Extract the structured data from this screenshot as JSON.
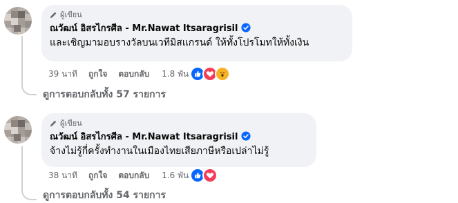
{
  "comments": [
    {
      "role_label": "ผู้เขียน",
      "author": "ณวัฒน์ อิสรไกรศีล - Mr.Nawat Itsaragrisil",
      "text": "และเชิญมามอบรางวัลบนเวทีมิสแกรนด์ ให้ทั้งโปรโมทให้ทั้งเงิน",
      "time": "39 นาที",
      "like_label": "ถูกใจ",
      "reply_label": "ตอบกลับ",
      "reaction_count": "1.8 พัน",
      "reactions": [
        "like-icon",
        "love-icon",
        "wow-icon"
      ],
      "replies_link": "ดูการตอบกลับทั้ง 57 รายการ"
    },
    {
      "role_label": "ผู้เขียน",
      "author": "ณวัฒน์ อิสรไกรศีล - Mr.Nawat Itsaragrisil",
      "text": "จ้างไม่รู้กี่ครั้งทำงานในเมืองไทยเสียภาษีหรือเปล่าไม่รู้",
      "time": "38 นาที",
      "like_label": "ถูกใจ",
      "reply_label": "ตอบกลับ",
      "reaction_count": "1.6 พัน",
      "reactions": [
        "like-icon",
        "love-icon"
      ],
      "replies_link": "ดูการตอบกลับทั้ง 54 รายการ"
    }
  ],
  "colors": {
    "bubble": "#f0f2f5",
    "meta_text": "#65676b",
    "verified": "#0866ff",
    "like": "#0866ff",
    "love": "#f33e58",
    "wow": "#f7b125"
  }
}
